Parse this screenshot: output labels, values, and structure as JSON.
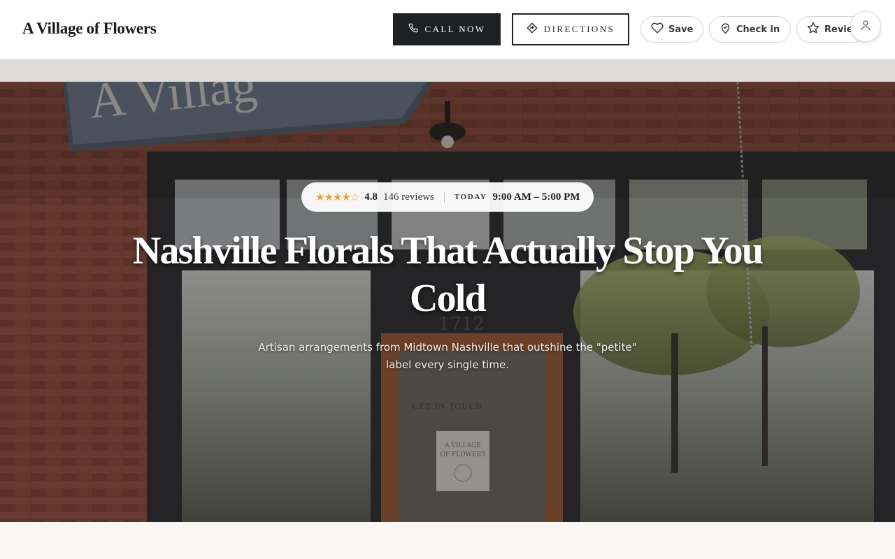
{
  "header": {
    "brand": "A Village of Flowers",
    "call_label": "CALL NOW",
    "directions_label": "DIRECTIONS",
    "save_label": "Save",
    "checkin_label": "Check in",
    "review_label": "Review",
    "icons": {
      "call": "phone-icon",
      "directions": "directions-icon",
      "save": "heart-icon",
      "checkin": "map-pin-icon",
      "review": "star-icon",
      "account": "user-icon"
    }
  },
  "hero": {
    "stars_display": "★★★★☆",
    "rating": "4.8",
    "reviews": "146 reviews",
    "today_label": "TODAY",
    "hours": "9:00 AM – 5:00 PM",
    "headline": "Nashville Florals That Actually Stop You Cold",
    "subhead": "Artisan arrangements from Midtown Nashville that outshine the \"petite\" label every single time.",
    "cta": "GET IN TOUCH",
    "sign_text": "A Villag",
    "street_number": "1712",
    "door_sign_line1": "A VILLAGE",
    "door_sign_line2": "OF FLOWERS"
  },
  "colors": {
    "dark_button": "#1f2024",
    "star": "#e7a23a",
    "brick": "#8a4a3c",
    "window_frame": "#2e3134",
    "door_wood": "#a0603a"
  }
}
